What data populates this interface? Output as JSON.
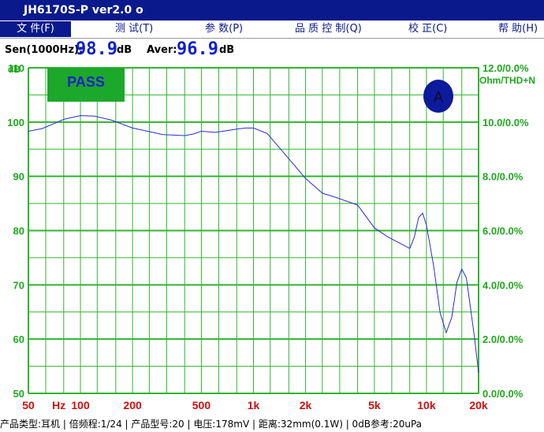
{
  "window": {
    "title": "JH6170S-P    ver2.0  o"
  },
  "menu": [
    {
      "label": "文 件(F)",
      "active": true
    },
    {
      "label": "测 试(T)",
      "active": false
    },
    {
      "label": "参 数(P)",
      "active": false
    },
    {
      "label": "品 质 控 制(Q)",
      "active": false
    },
    {
      "label": "校 正(C)",
      "active": false
    },
    {
      "label": "帮 助(H)",
      "active": false
    }
  ],
  "readout": {
    "sen_label": "Sen(1000Hz):",
    "sen_value": "98.9",
    "sen_unit": "dB",
    "aver_label": "Aver:",
    "aver_value": "96.9",
    "aver_unit": "dB"
  },
  "badges": {
    "pass": "PASS",
    "channel": "A"
  },
  "colors": {
    "grid": "#2fb52f",
    "curve": "#2a2adb",
    "pass_bg": "#1ca82a",
    "pass_text": "#1a22c8",
    "channel_bg": "#0d1a9a"
  },
  "chart_data": {
    "type": "line",
    "x_scale": "log",
    "xlim": [
      50,
      20000
    ],
    "ylim": [
      50,
      110
    ],
    "left_unit": "dB",
    "right_unit": "Ohm/THD+N",
    "x_tick_labels": [
      {
        "v": 50,
        "label": "50"
      },
      {
        "v": 75,
        "label": "Hz"
      },
      {
        "v": 100,
        "label": "100"
      },
      {
        "v": 200,
        "label": "200"
      },
      {
        "v": 500,
        "label": "500"
      },
      {
        "v": 1000,
        "label": "1k"
      },
      {
        "v": 2000,
        "label": "2k"
      },
      {
        "v": 5000,
        "label": "5k"
      },
      {
        "v": 10000,
        "label": "10k"
      },
      {
        "v": 20000,
        "label": "20k"
      }
    ],
    "y_left_ticks": [
      {
        "v": 110,
        "label": "110"
      },
      {
        "v": 100,
        "label": "100"
      },
      {
        "v": 90,
        "label": "90"
      },
      {
        "v": 80,
        "label": "80"
      },
      {
        "v": 70,
        "label": "70"
      },
      {
        "v": 60,
        "label": "60"
      },
      {
        "v": 50,
        "label": "50"
      }
    ],
    "y_right_ticks": [
      {
        "v": 110,
        "label": "12.0/0.0%"
      },
      {
        "v": 100,
        "label": "10.0/0.0%"
      },
      {
        "v": 90,
        "label": "8.0/0.0%"
      },
      {
        "v": 80,
        "label": "6.0/0.0%"
      },
      {
        "v": 70,
        "label": "4.0/0.0%"
      },
      {
        "v": 60,
        "label": "2.0/0.0%"
      },
      {
        "v": 50,
        "label": "0.0/0.0%"
      }
    ],
    "series": [
      {
        "x": [
          50,
          60,
          70,
          80,
          100,
          120,
          150,
          200,
          300,
          400,
          450,
          500,
          600,
          700,
          800,
          900,
          1000,
          1200,
          1500,
          2000,
          2500,
          3000,
          4000,
          5000,
          6000,
          7000,
          8000,
          8500,
          9000,
          9500,
          10000,
          11000,
          12000,
          13000,
          14000,
          15000,
          16000,
          17000,
          18000,
          19000,
          20000
        ],
        "y": [
          98.3,
          98.8,
          99.7,
          100.5,
          101.2,
          101.1,
          100.4,
          98.9,
          97.7,
          97.5,
          97.8,
          98.3,
          98.1,
          98.4,
          98.7,
          98.9,
          98.9,
          97.9,
          94.3,
          89.6,
          86.9,
          86.1,
          84.7,
          80.5,
          78.8,
          77.7,
          76.7,
          78.8,
          82.4,
          83.2,
          81.0,
          73.5,
          64.8,
          61.2,
          64.0,
          70.5,
          72.9,
          71.3,
          65.5,
          60.0,
          53.8
        ]
      }
    ]
  },
  "status": {
    "text": "产品类型:耳机  |  倍频程:1/24  |  产品型号:20  |  电压:178mV  |  距离:32mm(0.1W)  |  0dB参考:20uPa"
  }
}
